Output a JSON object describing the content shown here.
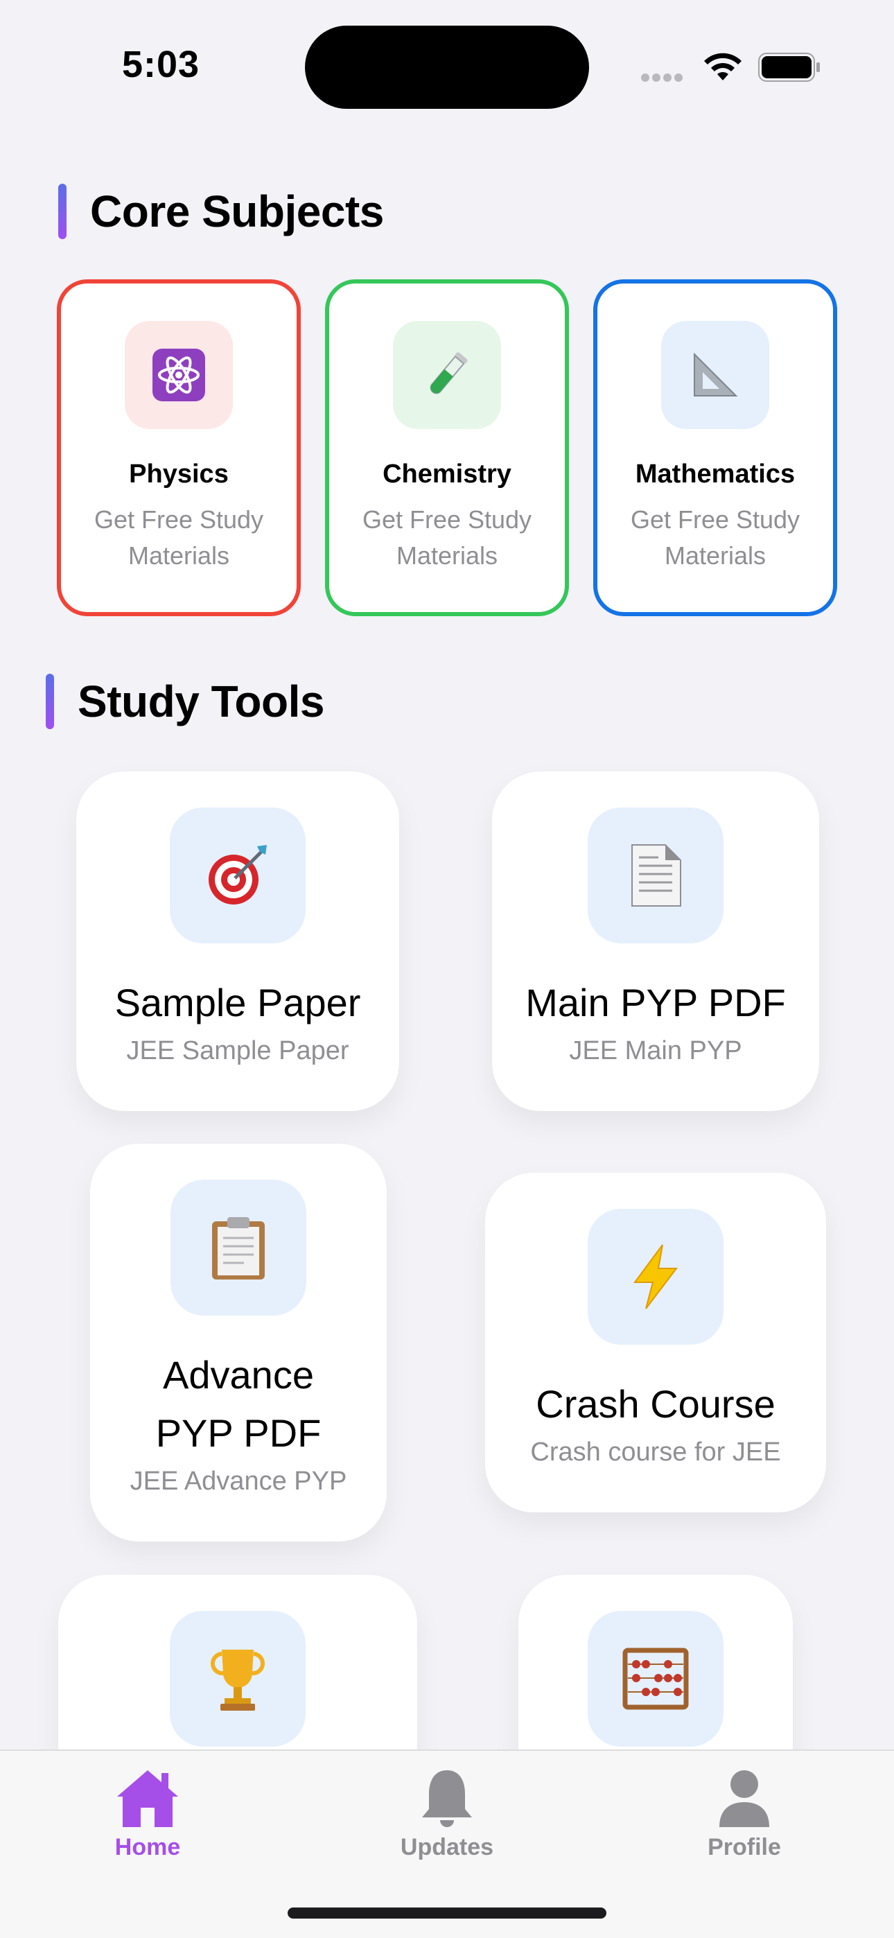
{
  "status_bar": {
    "time": "5:03"
  },
  "sections": {
    "core": {
      "title": "Core Subjects"
    },
    "tools": {
      "title": "Study Tools"
    }
  },
  "subjects": [
    {
      "name": "Physics",
      "subtitle": "Get Free Study Materials",
      "icon": "atom-icon",
      "glyph": "⚛",
      "border": "#f04438",
      "tint": "#fde8e8",
      "glyph_color": "#ffffff",
      "glyph_bg": "#8e3fbf"
    },
    {
      "name": "Chemistry",
      "subtitle": "Get Free Study Materials",
      "icon": "test-tube-icon",
      "glyph": "🧪",
      "border": "#34c759",
      "tint": "#e6f6e9",
      "glyph_color": "#2fa84f"
    },
    {
      "name": "Mathematics",
      "subtitle": "Get Free Study Materials",
      "icon": "triangle-ruler-icon",
      "glyph": "📐",
      "border": "#1473e6",
      "tint": "#e6f0fc",
      "glyph_color": "#8e8e93"
    }
  ],
  "tools": [
    {
      "title": "Sample Paper",
      "subtitle": "JEE Sample Paper",
      "icon": "target-icon",
      "glyph": "🎯",
      "glyph_color": "#d6262b"
    },
    {
      "title": "Main PYP PDF",
      "subtitle": "JEE Main PYP",
      "icon": "document-icon",
      "glyph": "📄",
      "glyph_color": "#8e8e93"
    },
    {
      "title": "Advance PYP PDF",
      "subtitle": "JEE Advance PYP",
      "icon": "clipboard-icon",
      "glyph": "📋",
      "glyph_color": "#a0764a"
    },
    {
      "title": "Crash Course",
      "subtitle": "Crash course for JEE",
      "icon": "lightning-icon",
      "glyph": "⚡",
      "glyph_color": "#f5b400"
    },
    {
      "title": "",
      "subtitle": "",
      "icon": "trophy-icon",
      "glyph": "🏆",
      "glyph_color": "#e0a21a"
    },
    {
      "title": "",
      "subtitle": "",
      "icon": "abacus-icon",
      "glyph": "🧮",
      "glyph_color": "#c0392b"
    }
  ],
  "tab_bar": {
    "items": [
      {
        "label": "Home",
        "icon": "home-icon",
        "active": true
      },
      {
        "label": "Updates",
        "icon": "bell-icon",
        "active": false
      },
      {
        "label": "Profile",
        "icon": "person-icon",
        "active": false
      }
    ],
    "active_color": "#a64ee8",
    "inactive_color": "#8e8e93"
  }
}
